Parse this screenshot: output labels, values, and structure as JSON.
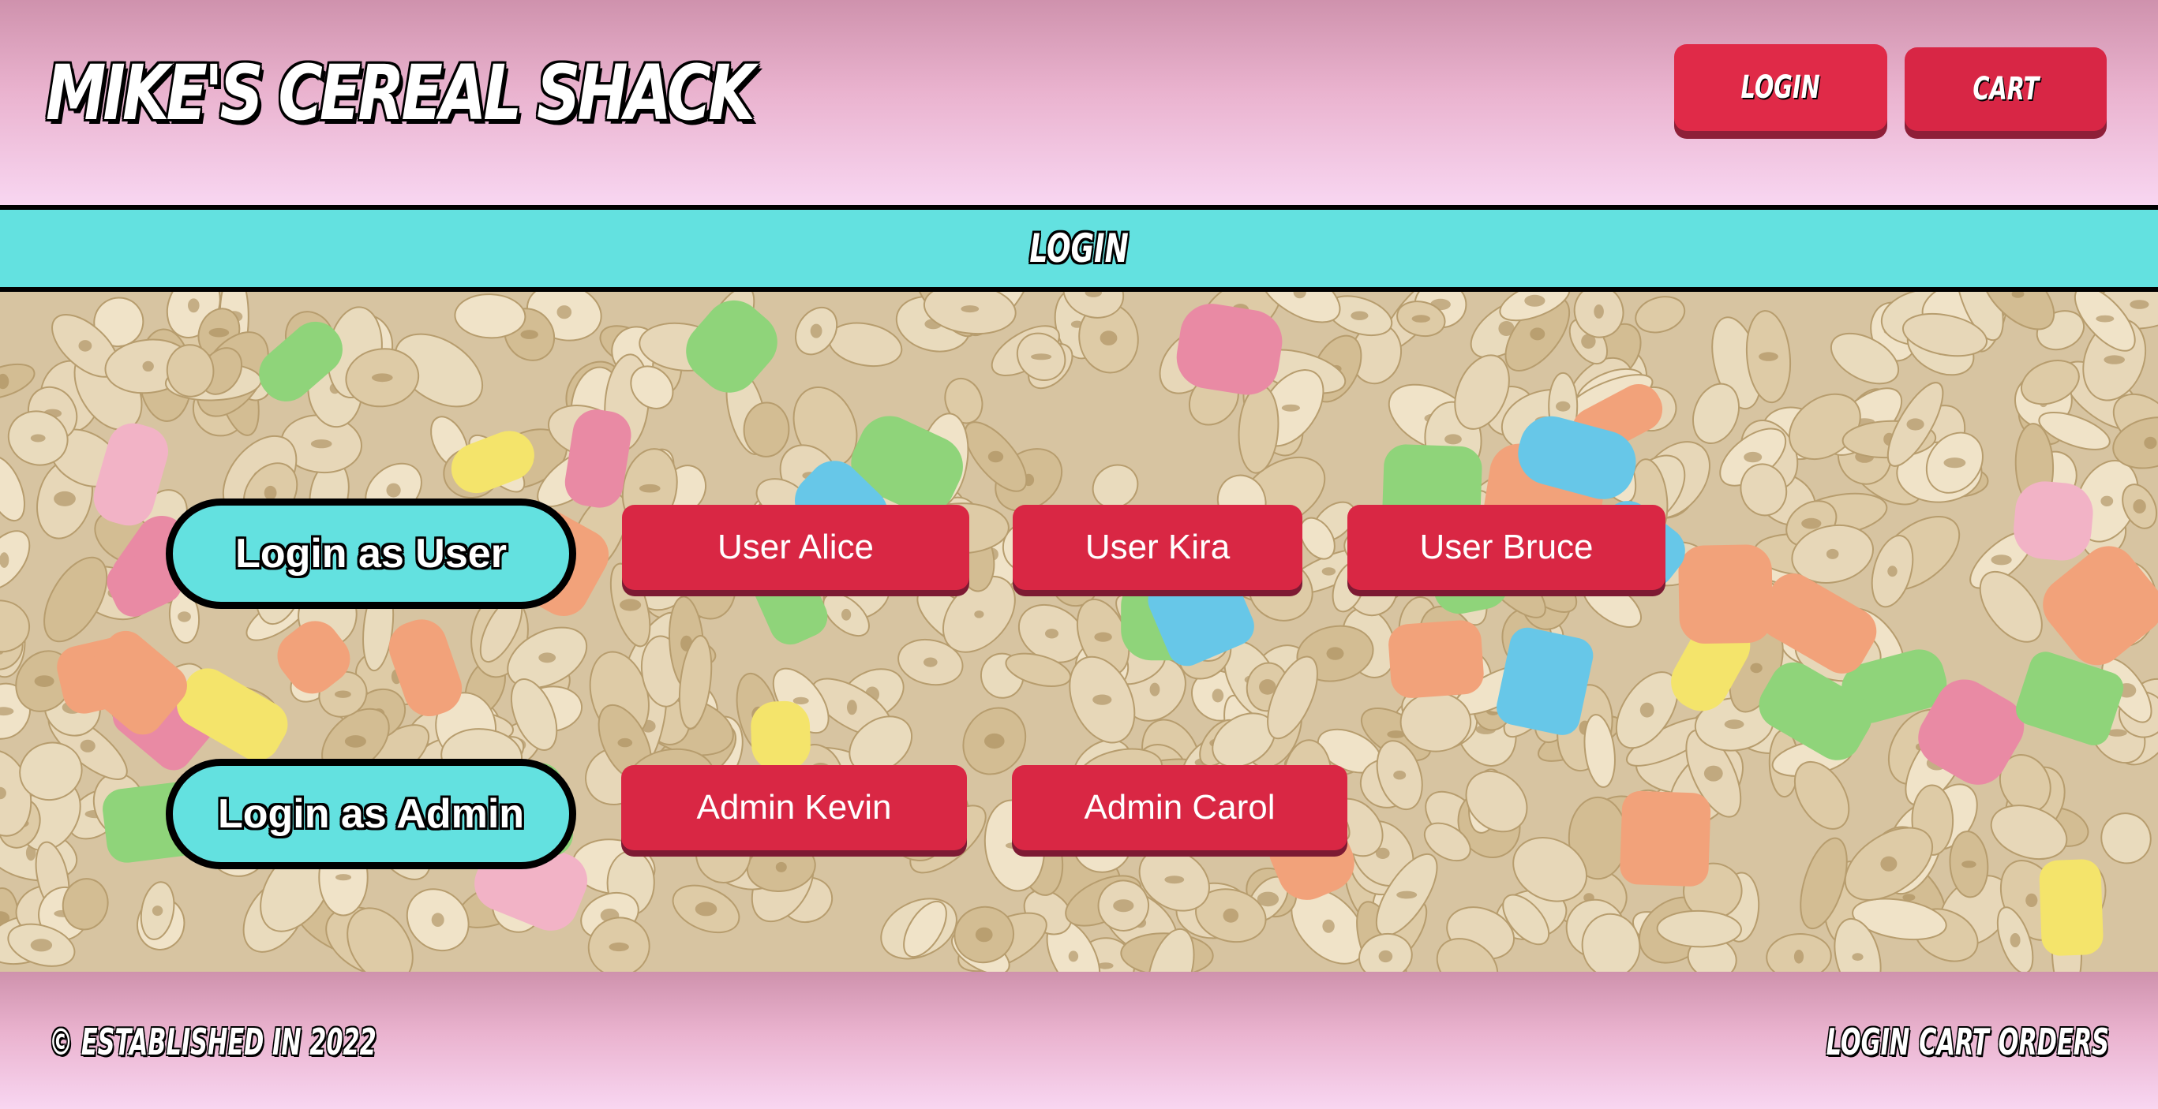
{
  "header": {
    "brand": "MIKE'S CEREAL SHACK",
    "nav": {
      "login": "LOGIN",
      "cart": "CART"
    }
  },
  "page": {
    "title": "LOGIN"
  },
  "login": {
    "user_label": "Login as User",
    "admin_label": "Login as Admin",
    "users": [
      "User Alice",
      "User Kira",
      "User Bruce"
    ],
    "admins": [
      "Admin Kevin",
      "Admin Carol"
    ]
  },
  "footer": {
    "copyright": "© ESTABLISHED IN 2022",
    "links": [
      "LOGIN",
      "CART",
      "ORDERS"
    ]
  },
  "colors": {
    "accent_red": "#d92744",
    "accent_cyan": "#63e1e0",
    "header_pink": "#eab3cf"
  }
}
